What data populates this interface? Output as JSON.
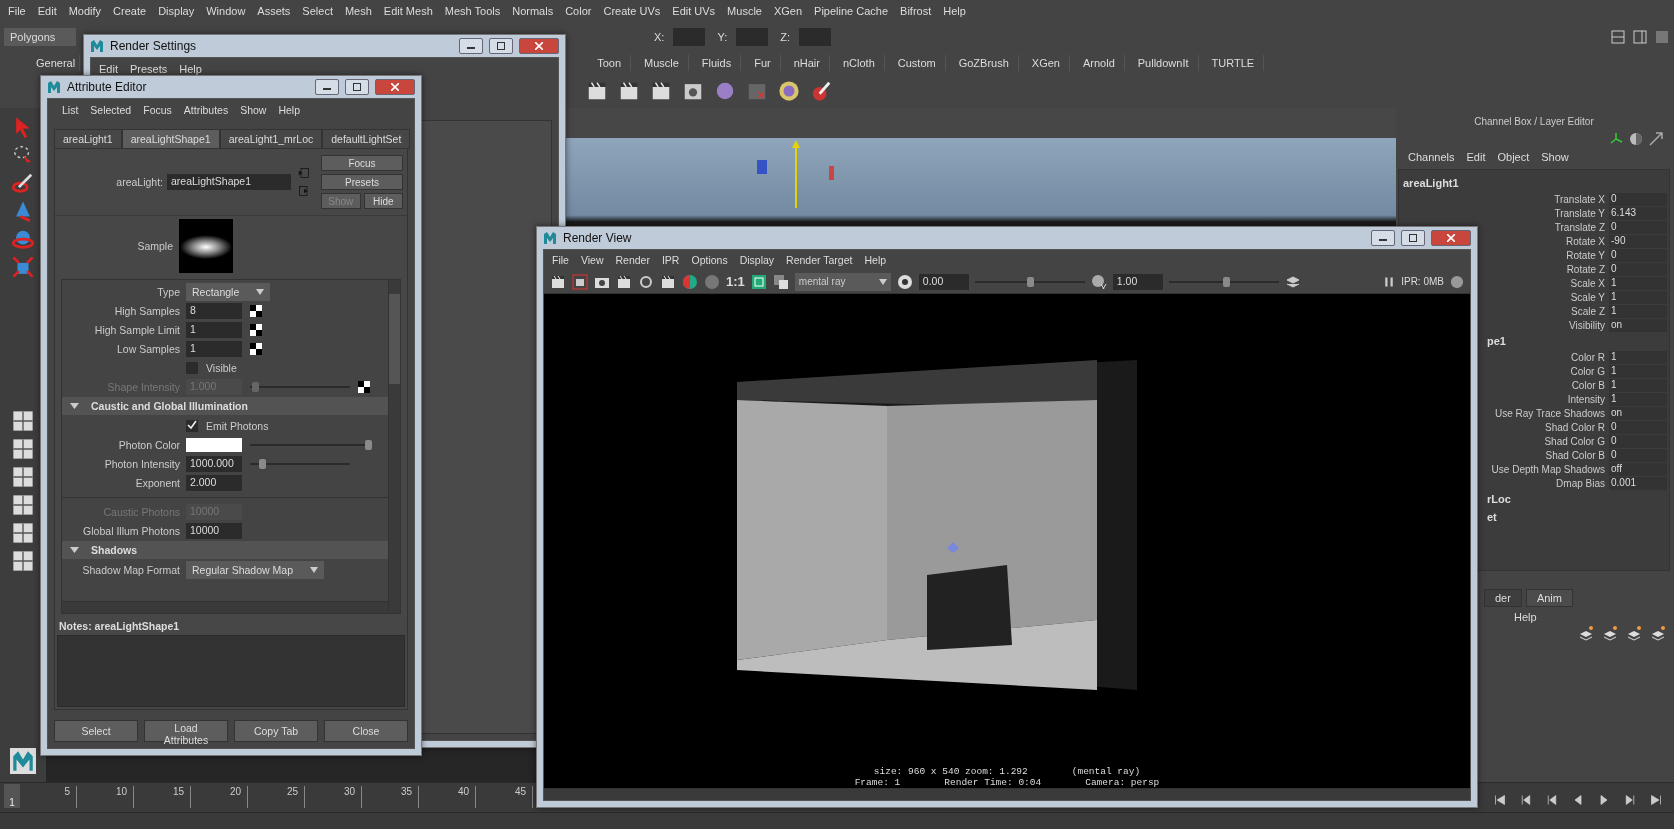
{
  "main_menu": [
    "File",
    "Edit",
    "Modify",
    "Create",
    "Display",
    "Window",
    "Assets",
    "Select",
    "Mesh",
    "Edit Mesh",
    "Mesh Tools",
    "Normals",
    "Color",
    "Create UVs",
    "Edit UVs",
    "Muscle",
    "XGen",
    "Pipeline Cache",
    "Bifrost",
    "Help"
  ],
  "status_line": {
    "menu_set": "Polygons",
    "coords": [
      "X:",
      "Y:",
      "Z:"
    ]
  },
  "shelf": {
    "tabs": [
      "General",
      "Toon",
      "Muscle",
      "Fluids",
      "Fur",
      "nHair",
      "nCloth",
      "Custom",
      "GoZBrush",
      "XGen",
      "Arnold",
      "PulldownIt",
      "TURTLE"
    ]
  },
  "render_settings": {
    "title": "Render Settings",
    "menu": [
      "Edit",
      "Presets",
      "Help"
    ]
  },
  "attribute_editor": {
    "title": "Attribute Editor",
    "menu": [
      "List",
      "Selected",
      "Focus",
      "Attributes",
      "Show",
      "Help"
    ],
    "tabs": [
      {
        "label": "areaLight1",
        "selected": false
      },
      {
        "label": "areaLightShape1",
        "selected": true
      },
      {
        "label": "areaLight1_mrLoc",
        "selected": false
      },
      {
        "label": "defaultLightSet",
        "selected": false
      }
    ],
    "node": {
      "label": "areaLight:",
      "value": "areaLightShape1"
    },
    "side_buttons": [
      {
        "label": "Focus",
        "disabled": false
      },
      {
        "label": "Presets",
        "disabled": false
      },
      {
        "label": "Show",
        "disabled": true
      },
      {
        "label": "Hide",
        "disabled": false
      }
    ],
    "sample": {
      "label": "Sample"
    },
    "attributes": [
      {
        "kind": "dropdown",
        "label": "Type",
        "value": "Rectangle"
      },
      {
        "kind": "field",
        "label": "High Samples",
        "value": "8",
        "disabled": false,
        "map": true
      },
      {
        "kind": "field",
        "label": "High Sample Limit",
        "value": "1",
        "disabled": false,
        "map": true
      },
      {
        "kind": "field",
        "label": "Low Samples",
        "value": "1",
        "disabled": false,
        "map": true
      },
      {
        "kind": "checkbox",
        "label": "Visible",
        "checked": false
      },
      {
        "kind": "slider",
        "label": "Shape Intensity",
        "value": "1.000",
        "level": 0.05,
        "disabled": true,
        "map": true
      },
      {
        "kind": "section",
        "label": "Caustic and Global Illumination",
        "expanded": true
      },
      {
        "kind": "checkbox",
        "label": "Emit Photons",
        "checked": true
      },
      {
        "kind": "color",
        "label": "Photon Color",
        "color": "#ffffff",
        "level": 1
      },
      {
        "kind": "slider",
        "label": "Photon Intensity",
        "value": "1000.000",
        "level": 0.12,
        "disabled": false,
        "map": false
      },
      {
        "kind": "field",
        "label": "Exponent",
        "value": "2.000",
        "disabled": false,
        "map": false
      },
      {
        "kind": "separator"
      },
      {
        "kind": "field",
        "label": "Caustic Photons",
        "value": "10000",
        "disabled": true,
        "map": false
      },
      {
        "kind": "field",
        "label": "Global Illum Photons",
        "value": "10000",
        "disabled": false,
        "map": false
      },
      {
        "kind": "section",
        "label": "Shadows",
        "expanded": true
      },
      {
        "kind": "dropdown",
        "label": "Shadow Map Format",
        "value": "Regular Shadow Map"
      }
    ],
    "notes": "Notes:  areaLightShape1",
    "buttons": [
      "Select",
      "Load Attributes",
      "Copy Tab",
      "Close"
    ]
  },
  "channel_box": {
    "title": "Channel Box / Layer Editor",
    "menu": [
      "Channels",
      "Edit",
      "Object",
      "Show"
    ],
    "sections": [
      {
        "name": "areaLight1",
        "channels": [
          {
            "name": "Translate X",
            "value": "0"
          },
          {
            "name": "Translate Y",
            "value": "6.143"
          },
          {
            "name": "Translate Z",
            "value": "0"
          },
          {
            "name": "Rotate X",
            "value": "-90"
          },
          {
            "name": "Rotate Y",
            "value": "0"
          },
          {
            "name": "Rotate Z",
            "value": "0"
          },
          {
            "name": "Scale X",
            "value": "1"
          },
          {
            "name": "Scale Y",
            "value": "1"
          },
          {
            "name": "Scale Z",
            "value": "1"
          },
          {
            "name": "Visibility",
            "value": "on"
          }
        ]
      },
      {
        "name": "pe1",
        "channels": [
          {
            "name": "Color R",
            "value": "1"
          },
          {
            "name": "Color G",
            "value": "1"
          },
          {
            "name": "Color B",
            "value": "1"
          },
          {
            "name": "Intensity",
            "value": "1"
          },
          {
            "name": "Use Ray Trace Shadows",
            "value": "on"
          },
          {
            "name": "Shad Color R",
            "value": "0"
          },
          {
            "name": "Shad Color G",
            "value": "0"
          },
          {
            "name": "Shad Color B",
            "value": "0"
          },
          {
            "name": "Use Depth Map Shadows",
            "value": "off"
          },
          {
            "name": "Dmap Bias",
            "value": "0.001"
          }
        ]
      },
      {
        "name": "rLoc"
      },
      {
        "name": "et"
      }
    ],
    "layer_tabs": [
      {
        "label": "der",
        "selected": false
      },
      {
        "label": "Anim",
        "selected": true
      }
    ],
    "layer_menu": [
      "Help"
    ]
  },
  "render_view": {
    "title": "Render View",
    "menu": [
      "File",
      "View",
      "Render",
      "IPR",
      "Options",
      "Display",
      "Render Target",
      "Help"
    ],
    "ratio": "1:1",
    "renderer": "mental ray",
    "exposure": {
      "value": "0.00",
      "level": 0.5
    },
    "gamma": {
      "value": "1.00",
      "level": 0.52
    },
    "ipr": "IPR: 0MB",
    "info": [
      [
        "size: 960 x 540 zoom: 1.292",
        "(mental ray)"
      ],
      [
        "Frame: 1",
        "Render Time: 0:04",
        "Camera: persp"
      ]
    ]
  },
  "timeline": {
    "current_frame": "1",
    "ticks": [
      "5",
      "10",
      "15",
      "20",
      "25",
      "30",
      "35",
      "40",
      "45"
    ]
  }
}
